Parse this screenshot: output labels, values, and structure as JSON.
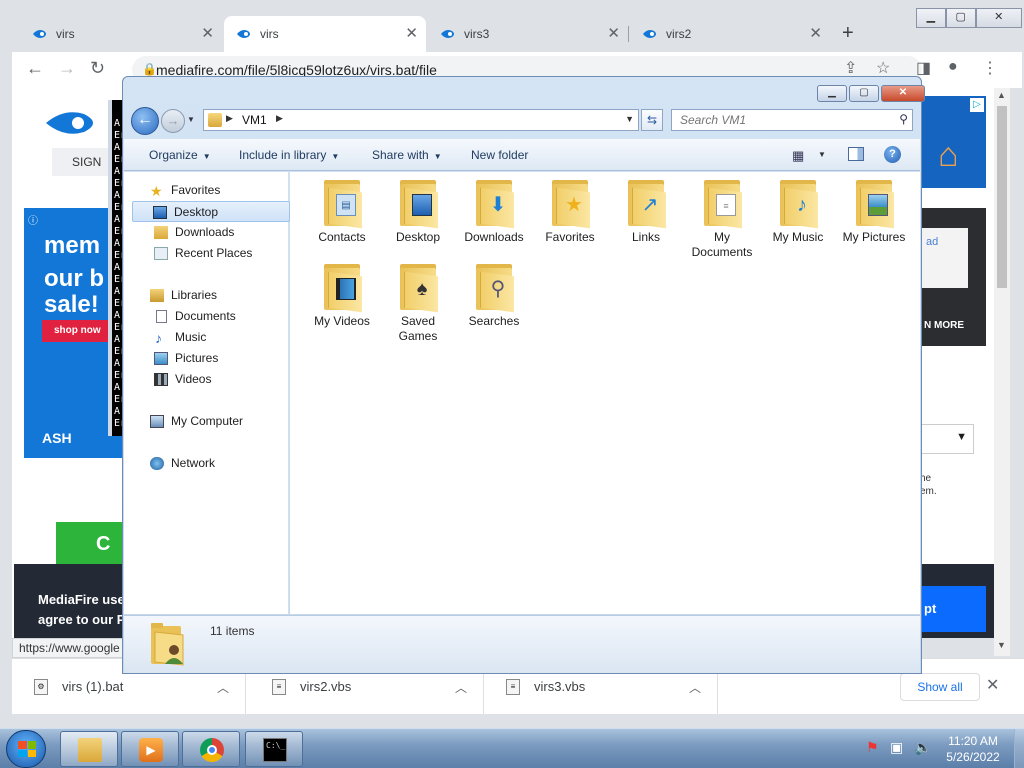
{
  "browser": {
    "tabs": [
      {
        "label": "virs",
        "active": false
      },
      {
        "label": "virs",
        "active": true
      },
      {
        "label": "virs3",
        "active": false
      },
      {
        "label": "virs2",
        "active": false
      }
    ],
    "url": "mediafire.com/file/5l8icq59lotz6ux/virs.bat/file",
    "status_url": "https://www.google",
    "page": {
      "signin": "SIGN",
      "ad_line1": "mem",
      "ad_line2": "our b",
      "ad_line3": "sale!",
      "shop_now": "shop now",
      "ashley": "ASH",
      "green_btn": "C",
      "consent_line1": "MediaFire use",
      "consent_line2": "agree to our P",
      "accept": "pt",
      "right_link": "ad",
      "learn_more": "N MORE",
      "right_text1": "he",
      "right_text2": "em.",
      "cmd_lines": [
        "A",
        "Er",
        "A",
        "Er",
        "A",
        "Er",
        "A",
        "Er",
        "A",
        "Er",
        "A",
        "Er",
        "A",
        "Er",
        "A",
        "Er",
        "A",
        "Er",
        "A",
        "Er",
        "A",
        "Er",
        "A",
        "Er",
        "A",
        "Er"
      ]
    },
    "downloads": [
      {
        "name": "virs (1).bat"
      },
      {
        "name": "virs2.vbs"
      },
      {
        "name": "virs3.vbs"
      }
    ],
    "show_all": "Show all"
  },
  "explorer": {
    "address_path": "VM1",
    "search_placeholder": "Search VM1",
    "commands": {
      "organize": "Organize",
      "include": "Include in library",
      "share": "Share with",
      "new_folder": "New folder"
    },
    "nav": {
      "favorites": "Favorites",
      "desktop": "Desktop",
      "downloads": "Downloads",
      "recent": "Recent Places",
      "libraries": "Libraries",
      "documents": "Documents",
      "music": "Music",
      "pictures": "Pictures",
      "videos": "Videos",
      "computer": "My Computer",
      "network": "Network"
    },
    "items": {
      "contacts": "Contacts",
      "desktop": "Desktop",
      "downloads": "Downloads",
      "favorites": "Favorites",
      "links": "Links",
      "documents_1": "My",
      "documents_2": "Documents",
      "music": "My Music",
      "pictures": "My Pictures",
      "videos": "My Videos",
      "games_1": "Saved",
      "games_2": "Games",
      "searches": "Searches"
    },
    "item_count": "11 items"
  },
  "taskbar": {
    "time": "11:20 AM",
    "date": "5/26/2022"
  },
  "colors": {
    "mediafire_blue": "#1277d6",
    "win7_accent": "#2a6ac0"
  }
}
